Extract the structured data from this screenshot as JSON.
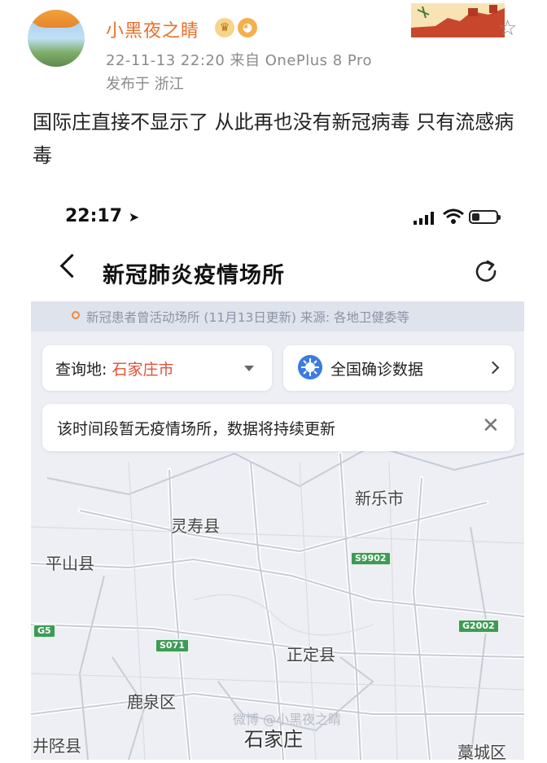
{
  "post": {
    "username": "小黑夜之睛",
    "badges": [
      "crown-icon",
      "fish-icon"
    ],
    "meta": "22-11-13 22:20  来自 OnePlus 8 Pro",
    "location": "发布于 浙江",
    "text": "国际庄直接不显示了  从此再也没有新冠病毒  只有流感病毒"
  },
  "phone": {
    "status": {
      "time": "22:17",
      "location_arrow": "➤"
    },
    "nav": {
      "title": "新冠肺炎疫情场所"
    },
    "source_bar": {
      "text": "新冠患者曾活动场所 (11月13日更新)   来源: 各地卫健委等"
    },
    "query": {
      "label": "查询地: ",
      "city": "石家庄市"
    },
    "national_button": {
      "label": "全国确诊数据"
    },
    "notice": {
      "text": "该时间段暂无疫情场所，数据将持续更新",
      "close": "✕"
    },
    "map": {
      "places": {
        "xinle": "新乐市",
        "lingshou": "灵寿县",
        "pingshan": "平山县",
        "zhengding": "正定县",
        "luquan": "鹿泉区",
        "shijiazhuang": "石家庄",
        "jingxing": "井陉县",
        "gaocheng": "藁城区"
      },
      "roads": {
        "s9902": "S9902",
        "g5": "G5",
        "s071": "S071",
        "g2002": "G2002"
      },
      "watermark": "微博 @小黑夜之睛"
    }
  },
  "colors": {
    "username": "#e8702a",
    "city": "#e0533a",
    "map_bg": "#edeff4",
    "road_shield": "#3e9b54",
    "virus_icon": "#3d7be0"
  }
}
